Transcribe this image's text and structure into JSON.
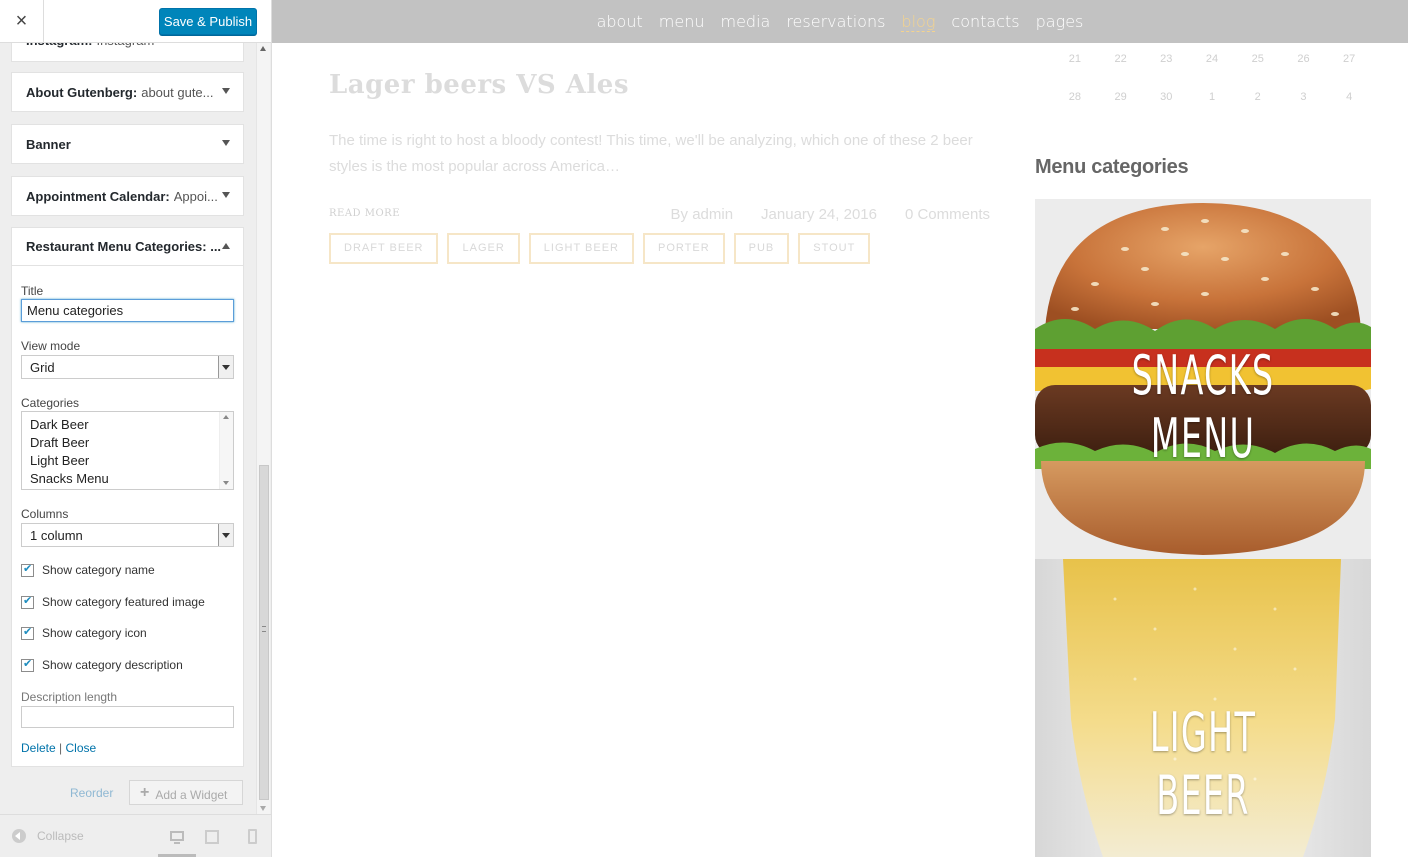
{
  "sidebar": {
    "close_label": "×",
    "save_label": "Save & Publish",
    "panels": [
      {
        "title": "Instagram:",
        "subtitle": "Instagram"
      },
      {
        "title": "About Gutenberg:",
        "subtitle": "about gute..."
      },
      {
        "title": "Banner",
        "subtitle": ""
      },
      {
        "title": "Appointment Calendar:",
        "subtitle": "Appoi..."
      },
      {
        "title": "Restaurant Menu Categories: ...",
        "subtitle": ""
      }
    ],
    "form": {
      "title_label": "Title",
      "title_value": "Menu categories",
      "view_mode_label": "View mode",
      "view_mode_value": "Grid",
      "categories_label": "Categories",
      "categories": [
        "Dark Beer",
        "Draft Beer",
        "Light Beer",
        "Snacks Menu"
      ],
      "columns_label": "Columns",
      "columns_value": "1 column",
      "checkboxes": [
        {
          "label": "Show category name",
          "checked": true
        },
        {
          "label": "Show category featured image",
          "checked": true
        },
        {
          "label": "Show category icon",
          "checked": true
        },
        {
          "label": "Show category description",
          "checked": true
        }
      ],
      "desc_length_label": "Description length",
      "desc_length_value": "",
      "delete_label": "Delete",
      "separator": "|",
      "close_label": "Close"
    },
    "reorder_label": "Reorder",
    "add_widget_label": "Add a Widget",
    "collapse_label": "Collapse"
  },
  "preview": {
    "nav": [
      "about",
      "menu",
      "media",
      "reservations",
      "blog",
      "contacts",
      "pages"
    ],
    "nav_active": "blog",
    "post_title": "Lager beers VS Ales",
    "post_excerpt": "The time is right to host a bloody contest! This time, we'll be analyzing, which one of these 2 beer styles is the most popular across America…",
    "read_more": "READ MORE",
    "author": "By admin",
    "date": "January 24, 2016",
    "comments": "0 Comments",
    "tags": [
      "DRAFT BEER",
      "LAGER",
      "LIGHT BEER",
      "PORTER",
      "PUB",
      "STOUT"
    ],
    "calendar_rows": [
      [
        "21",
        "22",
        "23",
        "24",
        "25",
        "26",
        "27"
      ],
      [
        "28",
        "29",
        "30",
        "1",
        "2",
        "3",
        "4"
      ]
    ],
    "widget_title": "Menu categories",
    "category_tiles": [
      {
        "name": "SNACKS MENU",
        "image": "burger"
      },
      {
        "name": "LIGHT BEER",
        "image": "beer-glass"
      }
    ]
  },
  "colors": {
    "primary_button": "#0085ba",
    "nav_bar": "#c2c2c2",
    "nav_active": "#f4d38e",
    "tag_border": "#f6e6c7"
  }
}
